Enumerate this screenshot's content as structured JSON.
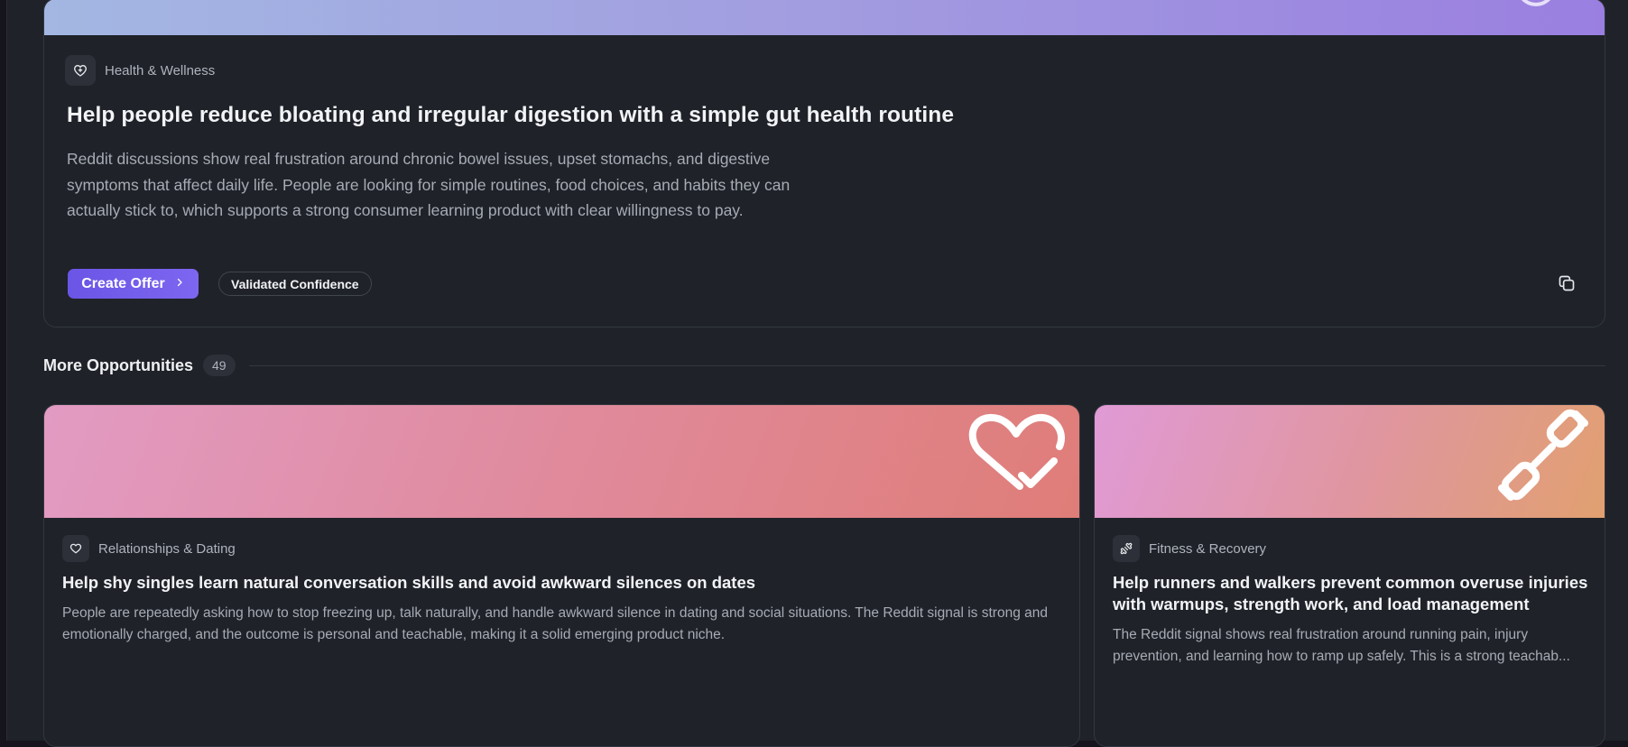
{
  "featured": {
    "category": "Health & Wellness",
    "category_icon": "heart-shield-icon",
    "title": "Help people reduce bloating and irregular digestion with a simple gut health routine",
    "description": "Reddit discussions show real frustration around chronic bowel issues, upset stomachs, and digestive symptoms that affect daily life. People are looking for simple routines, food choices, and habits they can actually stick to, which supports a strong consumer learning product with clear willingness to pay.",
    "create_button": "Create Offer",
    "confidence_badge": "Validated Confidence",
    "copy_icon": "copy-icon",
    "banner_colors": [
      "#a3b7e2",
      "#9a7fe0"
    ]
  },
  "section": {
    "title": "More Opportunities",
    "count": "49"
  },
  "opportunities": [
    {
      "category": "Relationships & Dating",
      "category_icon": "heart-icon",
      "banner_icon": "heart-check-icon",
      "title": "Help shy singles learn natural conversation skills and avoid awkward silences on dates",
      "description": "People are repeatedly asking how to stop freezing up, talk naturally, and handle awkward silence in dating and social situations. The Reddit signal is strong and emotionally charged, and the outcome is personal and teachable, making it a solid emerging product niche.",
      "banner_colors": [
        "#e29bc3",
        "#df7d78"
      ]
    },
    {
      "category": "Fitness & Recovery",
      "category_icon": "dumbbell-icon",
      "banner_icon": "dumbbell-icon",
      "title": "Help runners and walkers prevent common overuse injuries with warmups, strength work, and load management",
      "description_line1": "The Reddit signal shows real frustration around running pain, injury",
      "description_line2": "prevention, and learning how to ramp up safely. This is a strong teachab...",
      "banner_colors": [
        "#e09ad6",
        "#e1a070"
      ]
    }
  ]
}
